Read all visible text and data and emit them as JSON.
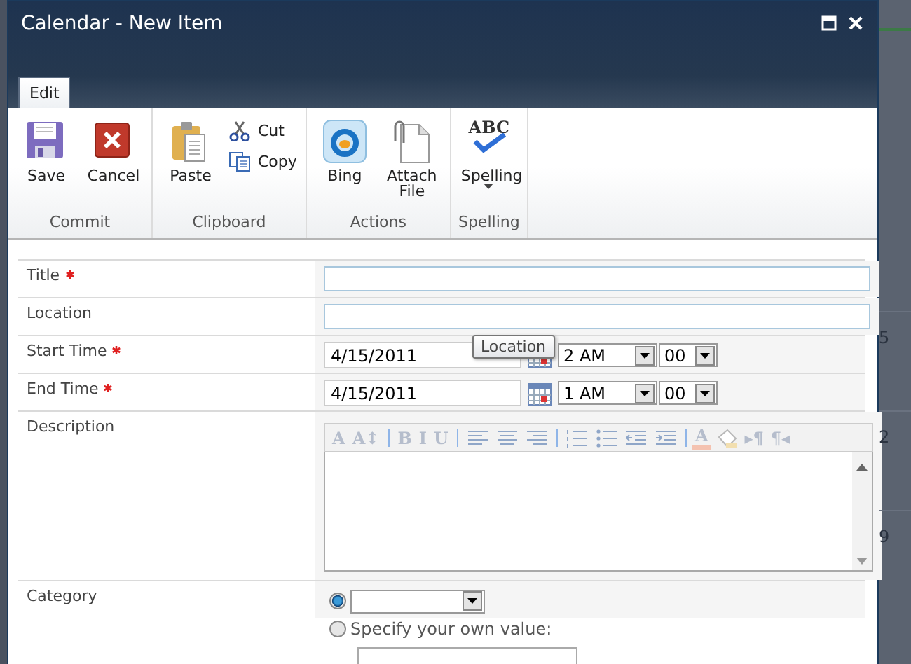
{
  "window": {
    "title": "Calendar - New Item"
  },
  "ribbon": {
    "tabs": [
      {
        "label": "Edit",
        "selected": true
      }
    ],
    "groups": [
      {
        "label": "Commit",
        "commands": [
          {
            "kind": "large",
            "label": "Save"
          },
          {
            "kind": "large",
            "label": "Cancel"
          }
        ]
      },
      {
        "label": "Clipboard",
        "commands": [
          {
            "kind": "large",
            "label": "Paste"
          },
          {
            "kind": "small",
            "label": "Cut"
          },
          {
            "kind": "small",
            "label": "Copy"
          }
        ]
      },
      {
        "label": "Actions",
        "commands": [
          {
            "kind": "large",
            "label": "Bing"
          },
          {
            "kind": "large",
            "label": "Attach File"
          }
        ]
      },
      {
        "label": "Spelling",
        "commands": [
          {
            "kind": "large",
            "label": "Spelling",
            "glyph": "ABC",
            "menu": true
          }
        ]
      }
    ]
  },
  "form": [
    {
      "kind": "text",
      "label": "Title",
      "required": true
    },
    {
      "kind": "text",
      "label": "Location",
      "required": false
    },
    {
      "kind": "datetime",
      "label": "Start Time",
      "required": true,
      "date": "4/15/2011",
      "hour": "2 AM",
      "minute": "00"
    },
    {
      "kind": "datetime",
      "label": "End Time",
      "required": true,
      "date": "4/15/2011",
      "hour": "1 AM",
      "minute": "00"
    },
    {
      "kind": "richtext",
      "label": "Description",
      "required": false,
      "toolbar": {
        "disabled": true,
        "groups": [
          [
            {
              "kind": "glyph",
              "text": "A"
            },
            {
              "kind": "glyph",
              "text": "A↕"
            }
          ],
          [
            {
              "kind": "glyph",
              "text": "B"
            },
            {
              "kind": "glyph",
              "text": "I"
            },
            {
              "kind": "glyph",
              "text": "U"
            }
          ],
          [
            {
              "kind": "align-left"
            },
            {
              "kind": "align-center"
            },
            {
              "kind": "align-right"
            }
          ],
          [
            {
              "kind": "numbered-list"
            },
            {
              "kind": "bullet-list"
            },
            {
              "kind": "outdent"
            },
            {
              "kind": "indent"
            }
          ],
          [
            {
              "kind": "font-color",
              "text": "A"
            },
            {
              "kind": "highlight"
            },
            {
              "kind": "glyph",
              "text": "▸¶"
            },
            {
              "kind": "glyph",
              "text": "¶◂"
            }
          ]
        ]
      }
    },
    {
      "kind": "choice",
      "label": "Category",
      "required": false,
      "options": [
        {
          "kind": "dropdown",
          "selected": true
        },
        {
          "kind": "custom",
          "label": "Specify your own value:",
          "selected": false
        }
      ]
    }
  ],
  "tooltip": {
    "text": "Location"
  },
  "background_calendar": {
    "days": [
      "5",
      "2",
      "9"
    ]
  }
}
